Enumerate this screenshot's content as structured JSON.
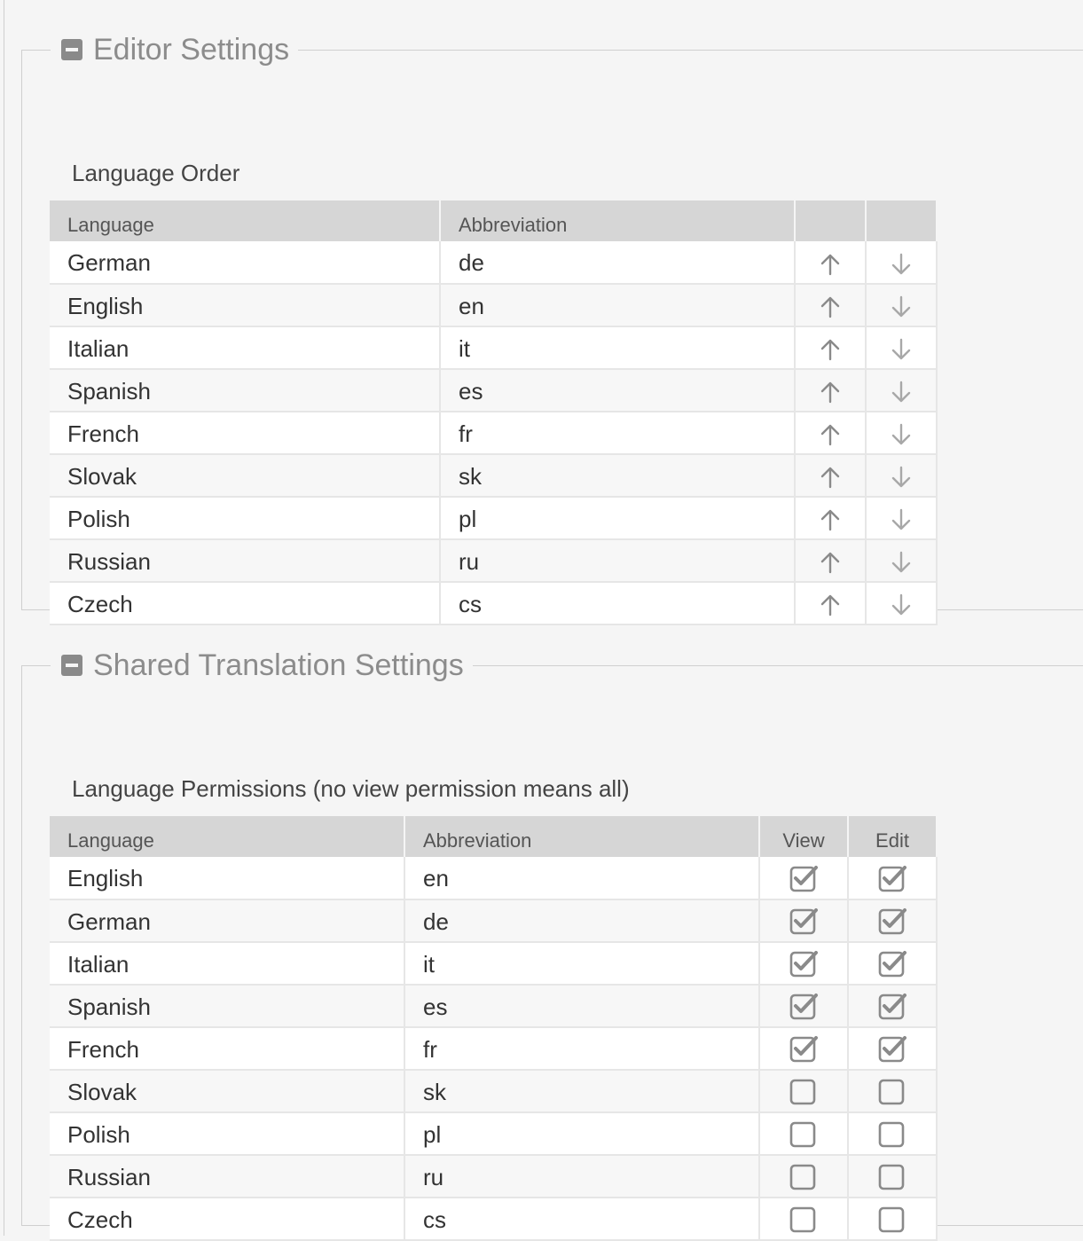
{
  "editor": {
    "title": "Editor Settings",
    "subtitle": "Language Order",
    "columns": [
      "Language",
      "Abbreviation",
      "",
      ""
    ],
    "rows": [
      {
        "language": "German",
        "abbr": "de"
      },
      {
        "language": "English",
        "abbr": "en"
      },
      {
        "language": "Italian",
        "abbr": "it"
      },
      {
        "language": "Spanish",
        "abbr": "es"
      },
      {
        "language": "French",
        "abbr": "fr"
      },
      {
        "language": "Slovak",
        "abbr": "sk"
      },
      {
        "language": "Polish",
        "abbr": "pl"
      },
      {
        "language": "Russian",
        "abbr": "ru"
      },
      {
        "language": "Czech",
        "abbr": "cs"
      }
    ],
    "icons": {
      "up": "arrow-up-icon",
      "down": "arrow-down-icon"
    }
  },
  "shared": {
    "title": "Shared Translation Settings",
    "subtitle": "Language Permissions (no view permission means all)",
    "columns": [
      "Language",
      "Abbreviation",
      "View",
      "Edit"
    ],
    "rows": [
      {
        "language": "English",
        "abbr": "en",
        "view": true,
        "edit": true
      },
      {
        "language": "German",
        "abbr": "de",
        "view": true,
        "edit": true
      },
      {
        "language": "Italian",
        "abbr": "it",
        "view": true,
        "edit": true
      },
      {
        "language": "Spanish",
        "abbr": "es",
        "view": true,
        "edit": true
      },
      {
        "language": "French",
        "abbr": "fr",
        "view": true,
        "edit": true
      },
      {
        "language": "Slovak",
        "abbr": "sk",
        "view": false,
        "edit": false
      },
      {
        "language": "Polish",
        "abbr": "pl",
        "view": false,
        "edit": false
      },
      {
        "language": "Russian",
        "abbr": "ru",
        "view": false,
        "edit": false
      },
      {
        "language": "Czech",
        "abbr": "cs",
        "view": false,
        "edit": false
      }
    ]
  },
  "colors": {
    "background": "#f5f5f5",
    "header": "#d6d6d6",
    "icon": "#8a8a8a",
    "legend": "#8c8c8c"
  }
}
